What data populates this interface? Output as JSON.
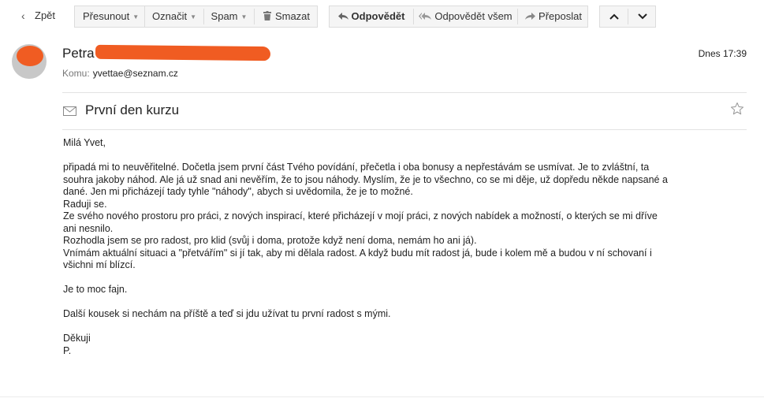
{
  "toolbar": {
    "back_label": "Zpět",
    "move_label": "Přesunout",
    "mark_label": "Označit",
    "spam_label": "Spam",
    "delete_label": "Smazat",
    "reply_label": "Odpovědět",
    "reply_all_label": "Odpovědět všem",
    "forward_label": "Přeposlat"
  },
  "message": {
    "sender_name": "Petra",
    "recipient_label": "Komu:",
    "recipient_address": "yvettae@seznam.cz",
    "date": "Dnes 17:39",
    "subject": "První den kurzu",
    "body": {
      "greeting": "Milá Yvet,",
      "line1": "připadá mi to neuvěřitelné. Dočetla jsem první část Tvého povídání, přečetla i oba bonusy a nepřestávám se usmívat. Je to zvláštní, ta",
      "line2": "souhra jakoby náhod. Ale já už snad ani nevěřím, že to jsou náhody. Myslím, že je to všechno, co se mi děje, už dopředu někde napsané a",
      "line3": "dané. Jen mi přicházejí tady tyhle \"náhody\", abych si uvědomila, že je to možné.",
      "line4": "Raduji se.",
      "line5": "Ze svého nového prostoru pro práci, z nových inspirací, které přicházejí v mojí práci, z nových nabídek a možností, o kterých se mi dříve",
      "line6": "ani nesnilo.",
      "line7": "Rozhodla jsem se pro radost, pro klid (svůj i doma, protože když není doma, nemám ho ani já).",
      "line8": "Vnímám aktuální situaci a \"přetvářím\" si jí tak, aby mi dělala radost. A když budu mít radost já, bude i kolem mě a budou v ní schovaní i",
      "line9": "všichni mí blízcí.",
      "line10": "Je to moc fajn.",
      "line11": "Další kousek si nechám na příště a teď si jdu užívat tu první radost s mými.",
      "closing": "Děkuji",
      "signature": "P."
    }
  }
}
